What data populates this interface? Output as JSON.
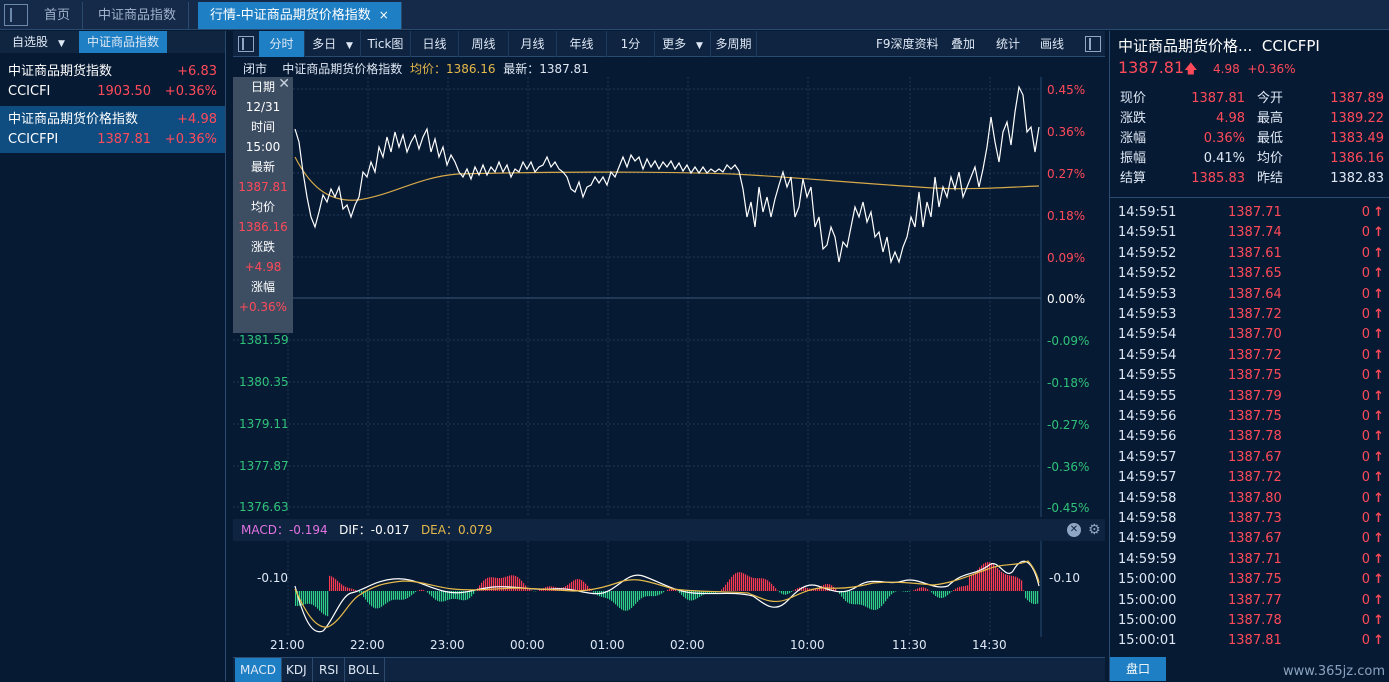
{
  "tabs": {
    "home": "首页",
    "index": "中证商品指数",
    "active": "行情-中证商品期货价格指数",
    "close": "×"
  },
  "left": {
    "tab_watch": "自选股",
    "tab_index": "中证商品指数",
    "items": [
      {
        "name": "中证商品期货指数",
        "change": "+6.83",
        "code": "CCICFI",
        "price": "1903.50",
        "pct": "+0.36%"
      },
      {
        "name": "中证商品期货价格指数",
        "change": "+4.98",
        "code": "CCICFPI",
        "price": "1387.81",
        "pct": "+0.36%"
      }
    ]
  },
  "toolbar": {
    "buttons": [
      "分时",
      "多日",
      "Tick图",
      "日线",
      "周线",
      "月线",
      "年线",
      "1分",
      "更多",
      "多周期"
    ],
    "right": [
      "F9深度资料",
      "叠加",
      "统计",
      "画线"
    ]
  },
  "chart_info": {
    "status": "闭市",
    "name": "中证商品期货价格指数",
    "avg": "均价：1386.16",
    "last": "最新：1387.81"
  },
  "tooltip": {
    "date_label": "日期",
    "date": "12/31",
    "time_label": "时间",
    "time": "15:00",
    "last_label": "最新",
    "last": "1387.81",
    "avg_label": "均价",
    "avg": "1386.16",
    "chg_label": "涨跌",
    "chg": "+4.98",
    "pct_label": "涨幅",
    "pct": "+0.36%"
  },
  "y_left_hidden": [
    "1381.59",
    "1380.35",
    "1379.11",
    "1377.87",
    "1376.63"
  ],
  "y_right_pos": [
    "0.45%",
    "0.36%",
    "0.27%",
    "0.18%",
    "0.09%"
  ],
  "y_right_zero": "0.00%",
  "y_right_neg": [
    "-0.09%",
    "-0.18%",
    "-0.27%",
    "-0.36%",
    "-0.45%"
  ],
  "macd": {
    "macd": "MACD：-0.194",
    "dif": "DIF：-0.017",
    "dea": "DEA：0.079",
    "axis": "-0.10"
  },
  "x_ticks": [
    "21:00",
    "22:00",
    "23:00",
    "00:00",
    "01:00",
    "02:00",
    "10:00",
    "11:30",
    "14:30"
  ],
  "indicator_tabs": [
    "MACD",
    "KDJ",
    "RSI",
    "BOLL"
  ],
  "chart_data": {
    "type": "line",
    "series": [],
    "x": [
      "21:00",
      "22:00",
      "23:00",
      "00:00",
      "01:00",
      "02:00",
      "10:00",
      "11:30",
      "14:30"
    ],
    "ylim": [
      1376.63,
      1389.22
    ]
  },
  "quote": {
    "title": "中证商品期货价格...",
    "code": "CCICFPI",
    "price": "1387.81",
    "change": "4.98",
    "pct": "+0.36%",
    "kv": [
      [
        "现价",
        "1387.81",
        "今开",
        "1387.89"
      ],
      [
        "涨跌",
        "4.98",
        "最高",
        "1389.22"
      ],
      [
        "涨幅",
        "0.36%",
        "最低",
        "1383.49"
      ],
      [
        "振幅",
        "0.41%",
        "均价",
        "1386.16"
      ],
      [
        "结算",
        "1385.83",
        "昨结",
        "1382.83"
      ]
    ],
    "ticks": [
      [
        "14:59:51",
        "1387.71",
        "0"
      ],
      [
        "14:59:51",
        "1387.74",
        "0"
      ],
      [
        "14:59:52",
        "1387.61",
        "0"
      ],
      [
        "14:59:52",
        "1387.65",
        "0"
      ],
      [
        "14:59:53",
        "1387.64",
        "0"
      ],
      [
        "14:59:53",
        "1387.72",
        "0"
      ],
      [
        "14:59:54",
        "1387.70",
        "0"
      ],
      [
        "14:59:54",
        "1387.72",
        "0"
      ],
      [
        "14:59:55",
        "1387.75",
        "0"
      ],
      [
        "14:59:55",
        "1387.79",
        "0"
      ],
      [
        "14:59:56",
        "1387.75",
        "0"
      ],
      [
        "14:59:56",
        "1387.78",
        "0"
      ],
      [
        "14:59:57",
        "1387.67",
        "0"
      ],
      [
        "14:59:57",
        "1387.72",
        "0"
      ],
      [
        "14:59:58",
        "1387.80",
        "0"
      ],
      [
        "14:59:58",
        "1387.73",
        "0"
      ],
      [
        "14:59:59",
        "1387.67",
        "0"
      ],
      [
        "14:59:59",
        "1387.71",
        "0"
      ],
      [
        "15:00:00",
        "1387.75",
        "0"
      ],
      [
        "15:00:00",
        "1387.77",
        "0"
      ],
      [
        "15:00:00",
        "1387.78",
        "0"
      ],
      [
        "15:00:01",
        "1387.81",
        "0"
      ]
    ],
    "pankou": "盘口"
  },
  "watermark": "www.365jz.com"
}
